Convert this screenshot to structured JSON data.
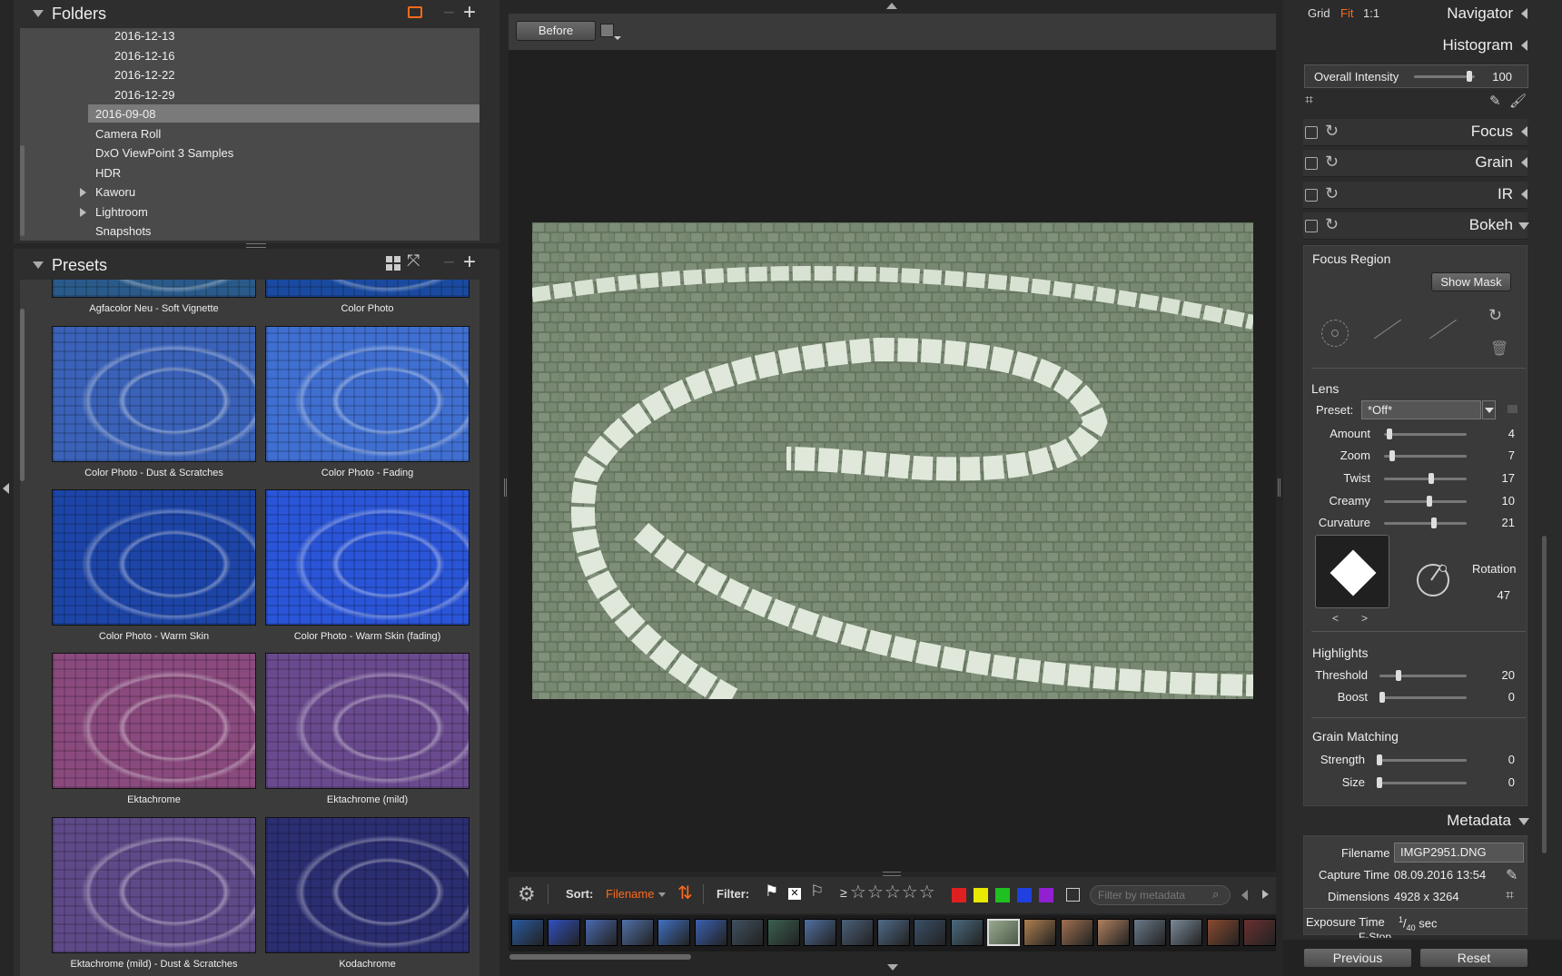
{
  "folders": {
    "title": "Folders",
    "items": [
      {
        "label": "2016-12-13"
      },
      {
        "label": "2016-12-16"
      },
      {
        "label": "2016-12-22"
      },
      {
        "label": "2016-12-29"
      },
      {
        "label": "2016-09-08",
        "selected": true
      },
      {
        "label": "Camera Roll"
      },
      {
        "label": "DxO ViewPoint 3 Samples"
      },
      {
        "label": "HDR"
      },
      {
        "label": "Kaworu",
        "expandable": true
      },
      {
        "label": "Lightroom",
        "expandable": true
      },
      {
        "label": "Snapshots"
      }
    ]
  },
  "presets": {
    "title": "Presets",
    "items": [
      {
        "label": "Agfacolor Neu - Soft Vignette",
        "color": "#2a5a8a"
      },
      {
        "label": "Color Photo",
        "color": "#1a4aa0"
      },
      {
        "label": "Color Photo - Dust & Scratches",
        "color": "#3a62b8"
      },
      {
        "label": "Color Photo - Fading",
        "color": "#3f6fd0"
      },
      {
        "label": "Color Photo - Warm Skin",
        "color": "#1d45a8"
      },
      {
        "label": "Color Photo - Warm Skin (fading)",
        "color": "#2a55d8"
      },
      {
        "label": "Ektachrome",
        "color": "#8a4a7e"
      },
      {
        "label": "Ektachrome (mild)",
        "color": "#6a4a8e"
      },
      {
        "label": "Ektachrome (mild) - Dust & Scratches",
        "color": "#5e4a88"
      },
      {
        "label": "Kodachrome",
        "color": "#2c2e72"
      }
    ]
  },
  "viewer": {
    "before_label": "Before"
  },
  "toolbar": {
    "sort_label": "Sort:",
    "sort_value": "Filename",
    "filter_label": "Filter:",
    "rating_prefix": "≥",
    "stars": "☆☆☆☆☆",
    "filter_placeholder": "Filter by metadata",
    "color_labels": [
      "#e02020",
      "#e8e800",
      "#20c020",
      "#2040e0",
      "#9020d0"
    ]
  },
  "filmstrip": {
    "thumbs": [
      "#2a5aa0",
      "#3050c0",
      "#4a6ab0",
      "#5070a8",
      "#4070c0",
      "#3a60b0",
      "#405060",
      "#3a6050",
      "#5070a0",
      "#4a6078",
      "#506a88",
      "#3a5068",
      "#4a6a80",
      "#6a7a6a",
      "#b08050",
      "#a07050",
      "#b08060",
      "#6a7a8a",
      "#7a8a98",
      "#8a4a30",
      "#6a3030"
    ]
  },
  "navigator": {
    "grid": "Grid",
    "fit": "Fit",
    "one_to_one": "1:1",
    "title": "Navigator"
  },
  "histogram": {
    "title": "Histogram",
    "overall_intensity_label": "Overall Intensity",
    "overall_intensity_value": "100"
  },
  "tools": {
    "focus": "Focus",
    "grain": "Grain",
    "ir": "IR",
    "bokeh": "Bokeh"
  },
  "bokeh": {
    "focus_region": "Focus Region",
    "show_mask": "Show Mask",
    "lens_title": "Lens",
    "preset_label": "Preset:",
    "preset_value": "*Off*",
    "sliders": [
      {
        "label": "Amount",
        "value": "4",
        "pos": 0.04
      },
      {
        "label": "Zoom",
        "value": "7",
        "pos": 0.07
      },
      {
        "label": "Twist",
        "value": "17",
        "pos": 0.58
      },
      {
        "label": "Creamy",
        "value": "10",
        "pos": 0.55
      },
      {
        "label": "Curvature",
        "value": "21",
        "pos": 0.61
      }
    ],
    "rotation_label": "Rotation",
    "rotation_value": "47",
    "prev_shape": "<",
    "next_shape": ">",
    "highlights_title": "Highlights",
    "highlight_sliders": [
      {
        "label": "Threshold",
        "value": "20",
        "pos": 0.2
      },
      {
        "label": "Boost",
        "value": "0",
        "pos": 0
      }
    ],
    "grain_title": "Grain Matching",
    "grain_sliders": [
      {
        "label": "Strength",
        "value": "0",
        "pos": 0
      },
      {
        "label": "Size",
        "value": "0",
        "pos": 0
      }
    ]
  },
  "metadata": {
    "title": "Metadata",
    "filename_label": "Filename",
    "filename_value": "IMGP2951.DNG",
    "capture_label": "Capture Time",
    "capture_value": "08.09.2016 13:54",
    "dimensions_label": "Dimensions",
    "dimensions_value": "4928 x 3264",
    "exposure_label": "Exposure Time",
    "exposure_num": "1",
    "exposure_den": "40",
    "exposure_unit": "sec",
    "fstop_label": "F-Stop"
  },
  "footer": {
    "previous": "Previous",
    "reset": "Reset"
  },
  "colors": {
    "accent": "#ff6a1a"
  }
}
